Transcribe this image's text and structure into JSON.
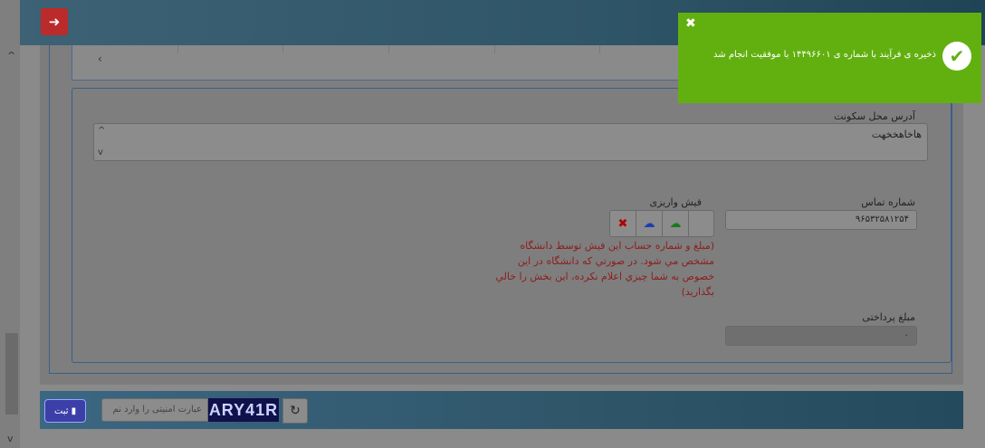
{
  "header": {
    "logout_icon": "logout-icon"
  },
  "form": {
    "address": {
      "label": "آدرس محل سکونت",
      "value": "هاخاهخخهت"
    },
    "phone": {
      "label": "شماره تماس",
      "value": "۹۶۵۳۲۵۸۱۲۵۴"
    },
    "receipt": {
      "label": "فیش واریزی",
      "note": "(مبلغ و شماره حساب این فیش توسط دانشگاه مشخص مي شود. در صورتي كه دانشگاه در اين خصوص به شما چيزي اعلام نكرده، اين بخش را خالي بگذاريد)"
    },
    "payment": {
      "label": "مبلغ پرداختی",
      "value": "۰"
    }
  },
  "footer": {
    "submit_label": "ثبت",
    "captcha_placeholder": "عبارت امنیتی را وارد نم",
    "captcha_text": "ARY41R"
  },
  "toast": {
    "message": "ذخیره ی فرآیند با شماره ی ۱۴۴۹۶۶۰۱ با موفقیت انجام شد"
  },
  "colors": {
    "toast_bg": "#62b010",
    "logout_bg": "#bb2b2b",
    "submit_bg": "#3c3fa8",
    "note_text": "#8f1c1c"
  }
}
